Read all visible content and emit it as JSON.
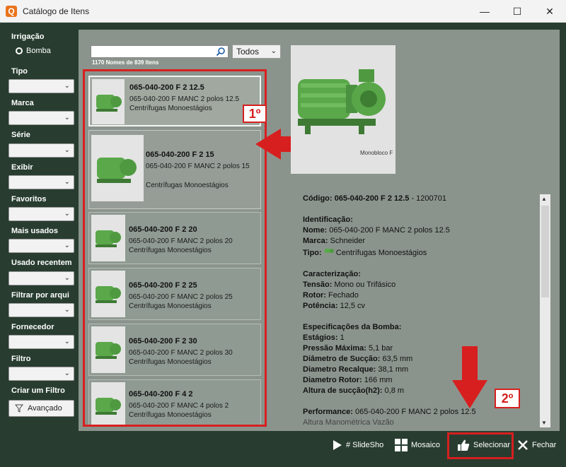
{
  "window": {
    "title": "Catálogo de Itens"
  },
  "sidebar": {
    "irrigacao_label": "Irrigação",
    "bomba_label": "Bomba",
    "filters": [
      {
        "label": "Tipo"
      },
      {
        "label": "Marca"
      },
      {
        "label": "Série"
      },
      {
        "label": "Exibir"
      },
      {
        "label": "Favoritos"
      },
      {
        "label": "Mais usados"
      },
      {
        "label": "Usado recentem"
      },
      {
        "label": "Filtrar por arqui"
      },
      {
        "label": "Fornecedor"
      },
      {
        "label": "Filtro"
      }
    ],
    "create_filter_label": "Criar um Filtro",
    "advanced_button": "Avançado"
  },
  "search": {
    "placeholder": "",
    "filter_value": "Todos",
    "count_text": "1170 Nomes de 839 Itens"
  },
  "items": [
    {
      "code": "065-040-200 F 2 12.5",
      "desc": "065-040-200 F MANC 2 polos 12.5",
      "category": "Centrífugas Monoestágios"
    },
    {
      "code": "065-040-200 F 2 15",
      "desc": "065-040-200 F MANC 2 polos 15",
      "category": "Centrífugas Monoestágios"
    },
    {
      "code": "065-040-200 F 2 20",
      "desc": "065-040-200 F MANC 2 polos 20",
      "category": "Centrífugas Monoestágios"
    },
    {
      "code": "065-040-200 F 2 25",
      "desc": "065-040-200 F MANC 2 polos 25",
      "category": "Centrífugas Monoestágios"
    },
    {
      "code": "065-040-200 F 2 30",
      "desc": "065-040-200 F MANC 2 polos 30",
      "category": "Centrífugas Monoestágios"
    },
    {
      "code": "065-040-200 F 4 2",
      "desc": "065-040-200 F MANC 4 polos 2",
      "category": "Centrífugas Monoestágios"
    }
  ],
  "preview": {
    "caption": "Monobloco F"
  },
  "annotations": {
    "first": "1º",
    "second": "2º"
  },
  "details": {
    "codigo_label": "Código: 065-040-200 F 2 12.5",
    "codigo_value": " - 1200701",
    "identificacao": "Identificação:",
    "nome_label": "Nome:",
    "nome_value": " 065-040-200 F MANC 2 polos 12.5",
    "marca_label": "Marca:",
    "marca_value": " Schneider",
    "tipo_label": "Tipo:",
    "tipo_value": " Centrífugas Monoestágios",
    "caracterizacao": "Caracterização:",
    "tensao_label": "Tensão:",
    "tensao_value": " Mono ou Trifásico",
    "rotor_label": "Rotor:",
    "rotor_value": " Fechado",
    "potencia_label": "Potência:",
    "potencia_value": " 12,5 cv",
    "especificacoes": "Especificações da Bomba:",
    "estagios_label": "Estágios:",
    "estagios_value": " 1",
    "pressao_label": "Pressão Máxima:",
    "pressao_value": " 5,1 bar",
    "succao_label": "Diâmetro de Sucção:",
    "succao_value": " 63,5 mm",
    "recalque_label": "Diametro Recalque:",
    "recalque_value": " 38,1 mm",
    "diam_rotor_label": "Diametro Rotor:",
    "diam_rotor_value": " 166 mm",
    "altura_label": "Altura de sucção(h2):",
    "altura_value": " 0,8 m",
    "performance_label": "Performance:",
    "performance_value": " 065-040-200 F MANC 2 polos 12.5",
    "cut_line": "Altura Manométrica        Vazão"
  },
  "bottom": {
    "slideshow": "# SlideSho",
    "mosaico": "Mosaico",
    "selecionar": "Selecionar",
    "fechar": "Fechar"
  },
  "colors": {
    "accent_red": "#d71f1f",
    "background": "#283d30",
    "panel": "#8b948c",
    "pump_green": "#5aa84a"
  }
}
